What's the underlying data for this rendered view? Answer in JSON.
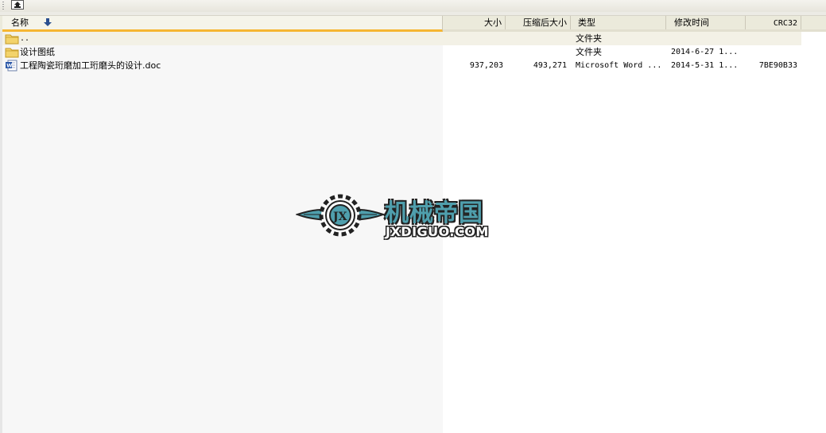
{
  "toolbar": {
    "up_icon": "up-folder-icon"
  },
  "columns": {
    "name": "名称",
    "size": "大小",
    "packed_size": "压缩后大小",
    "type": "类型",
    "modified": "修改时间",
    "crc": "CRC32"
  },
  "rows": [
    {
      "icon": "folder-icon",
      "name": "..",
      "size": "",
      "packed_size": "",
      "type": "文件夹",
      "modified": "",
      "crc": ""
    },
    {
      "icon": "folder-icon",
      "name": "设计图纸",
      "size": "",
      "packed_size": "",
      "type": "文件夹",
      "modified": "2014-6-27 1...",
      "crc": ""
    },
    {
      "icon": "word-doc-icon",
      "name": "工程陶瓷珩磨加工珩磨头的设计.doc",
      "size": "937,203",
      "packed_size": "493,271",
      "type": "Microsoft Word ...",
      "modified": "2014-5-31 1...",
      "crc": "7BE90B33"
    }
  ],
  "watermark": {
    "cn": "机械帝国",
    "en": "JXDIGUO.COM",
    "color": "#4f9fad"
  },
  "colors": {
    "sort_accent": "#f6b632",
    "selected_row": "#f3f1e6"
  }
}
